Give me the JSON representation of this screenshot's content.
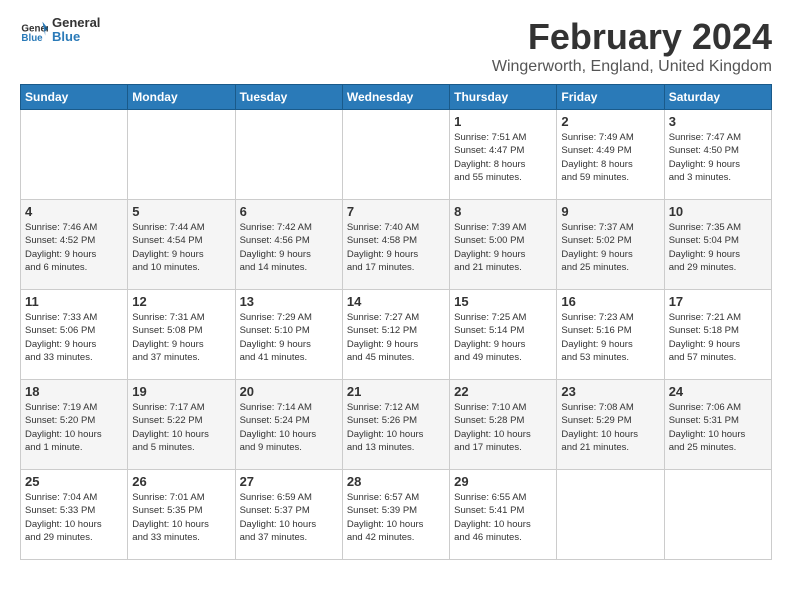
{
  "header": {
    "logo_line1": "General",
    "logo_line2": "Blue",
    "month": "February 2024",
    "location": "Wingerworth, England, United Kingdom"
  },
  "days_of_week": [
    "Sunday",
    "Monday",
    "Tuesday",
    "Wednesday",
    "Thursday",
    "Friday",
    "Saturday"
  ],
  "weeks": [
    [
      {
        "day": "",
        "info": ""
      },
      {
        "day": "",
        "info": ""
      },
      {
        "day": "",
        "info": ""
      },
      {
        "day": "",
        "info": ""
      },
      {
        "day": "1",
        "info": "Sunrise: 7:51 AM\nSunset: 4:47 PM\nDaylight: 8 hours\nand 55 minutes."
      },
      {
        "day": "2",
        "info": "Sunrise: 7:49 AM\nSunset: 4:49 PM\nDaylight: 8 hours\nand 59 minutes."
      },
      {
        "day": "3",
        "info": "Sunrise: 7:47 AM\nSunset: 4:50 PM\nDaylight: 9 hours\nand 3 minutes."
      }
    ],
    [
      {
        "day": "4",
        "info": "Sunrise: 7:46 AM\nSunset: 4:52 PM\nDaylight: 9 hours\nand 6 minutes."
      },
      {
        "day": "5",
        "info": "Sunrise: 7:44 AM\nSunset: 4:54 PM\nDaylight: 9 hours\nand 10 minutes."
      },
      {
        "day": "6",
        "info": "Sunrise: 7:42 AM\nSunset: 4:56 PM\nDaylight: 9 hours\nand 14 minutes."
      },
      {
        "day": "7",
        "info": "Sunrise: 7:40 AM\nSunset: 4:58 PM\nDaylight: 9 hours\nand 17 minutes."
      },
      {
        "day": "8",
        "info": "Sunrise: 7:39 AM\nSunset: 5:00 PM\nDaylight: 9 hours\nand 21 minutes."
      },
      {
        "day": "9",
        "info": "Sunrise: 7:37 AM\nSunset: 5:02 PM\nDaylight: 9 hours\nand 25 minutes."
      },
      {
        "day": "10",
        "info": "Sunrise: 7:35 AM\nSunset: 5:04 PM\nDaylight: 9 hours\nand 29 minutes."
      }
    ],
    [
      {
        "day": "11",
        "info": "Sunrise: 7:33 AM\nSunset: 5:06 PM\nDaylight: 9 hours\nand 33 minutes."
      },
      {
        "day": "12",
        "info": "Sunrise: 7:31 AM\nSunset: 5:08 PM\nDaylight: 9 hours\nand 37 minutes."
      },
      {
        "day": "13",
        "info": "Sunrise: 7:29 AM\nSunset: 5:10 PM\nDaylight: 9 hours\nand 41 minutes."
      },
      {
        "day": "14",
        "info": "Sunrise: 7:27 AM\nSunset: 5:12 PM\nDaylight: 9 hours\nand 45 minutes."
      },
      {
        "day": "15",
        "info": "Sunrise: 7:25 AM\nSunset: 5:14 PM\nDaylight: 9 hours\nand 49 minutes."
      },
      {
        "day": "16",
        "info": "Sunrise: 7:23 AM\nSunset: 5:16 PM\nDaylight: 9 hours\nand 53 minutes."
      },
      {
        "day": "17",
        "info": "Sunrise: 7:21 AM\nSunset: 5:18 PM\nDaylight: 9 hours\nand 57 minutes."
      }
    ],
    [
      {
        "day": "18",
        "info": "Sunrise: 7:19 AM\nSunset: 5:20 PM\nDaylight: 10 hours\nand 1 minute."
      },
      {
        "day": "19",
        "info": "Sunrise: 7:17 AM\nSunset: 5:22 PM\nDaylight: 10 hours\nand 5 minutes."
      },
      {
        "day": "20",
        "info": "Sunrise: 7:14 AM\nSunset: 5:24 PM\nDaylight: 10 hours\nand 9 minutes."
      },
      {
        "day": "21",
        "info": "Sunrise: 7:12 AM\nSunset: 5:26 PM\nDaylight: 10 hours\nand 13 minutes."
      },
      {
        "day": "22",
        "info": "Sunrise: 7:10 AM\nSunset: 5:28 PM\nDaylight: 10 hours\nand 17 minutes."
      },
      {
        "day": "23",
        "info": "Sunrise: 7:08 AM\nSunset: 5:29 PM\nDaylight: 10 hours\nand 21 minutes."
      },
      {
        "day": "24",
        "info": "Sunrise: 7:06 AM\nSunset: 5:31 PM\nDaylight: 10 hours\nand 25 minutes."
      }
    ],
    [
      {
        "day": "25",
        "info": "Sunrise: 7:04 AM\nSunset: 5:33 PM\nDaylight: 10 hours\nand 29 minutes."
      },
      {
        "day": "26",
        "info": "Sunrise: 7:01 AM\nSunset: 5:35 PM\nDaylight: 10 hours\nand 33 minutes."
      },
      {
        "day": "27",
        "info": "Sunrise: 6:59 AM\nSunset: 5:37 PM\nDaylight: 10 hours\nand 37 minutes."
      },
      {
        "day": "28",
        "info": "Sunrise: 6:57 AM\nSunset: 5:39 PM\nDaylight: 10 hours\nand 42 minutes."
      },
      {
        "day": "29",
        "info": "Sunrise: 6:55 AM\nSunset: 5:41 PM\nDaylight: 10 hours\nand 46 minutes."
      },
      {
        "day": "",
        "info": ""
      },
      {
        "day": "",
        "info": ""
      }
    ]
  ]
}
